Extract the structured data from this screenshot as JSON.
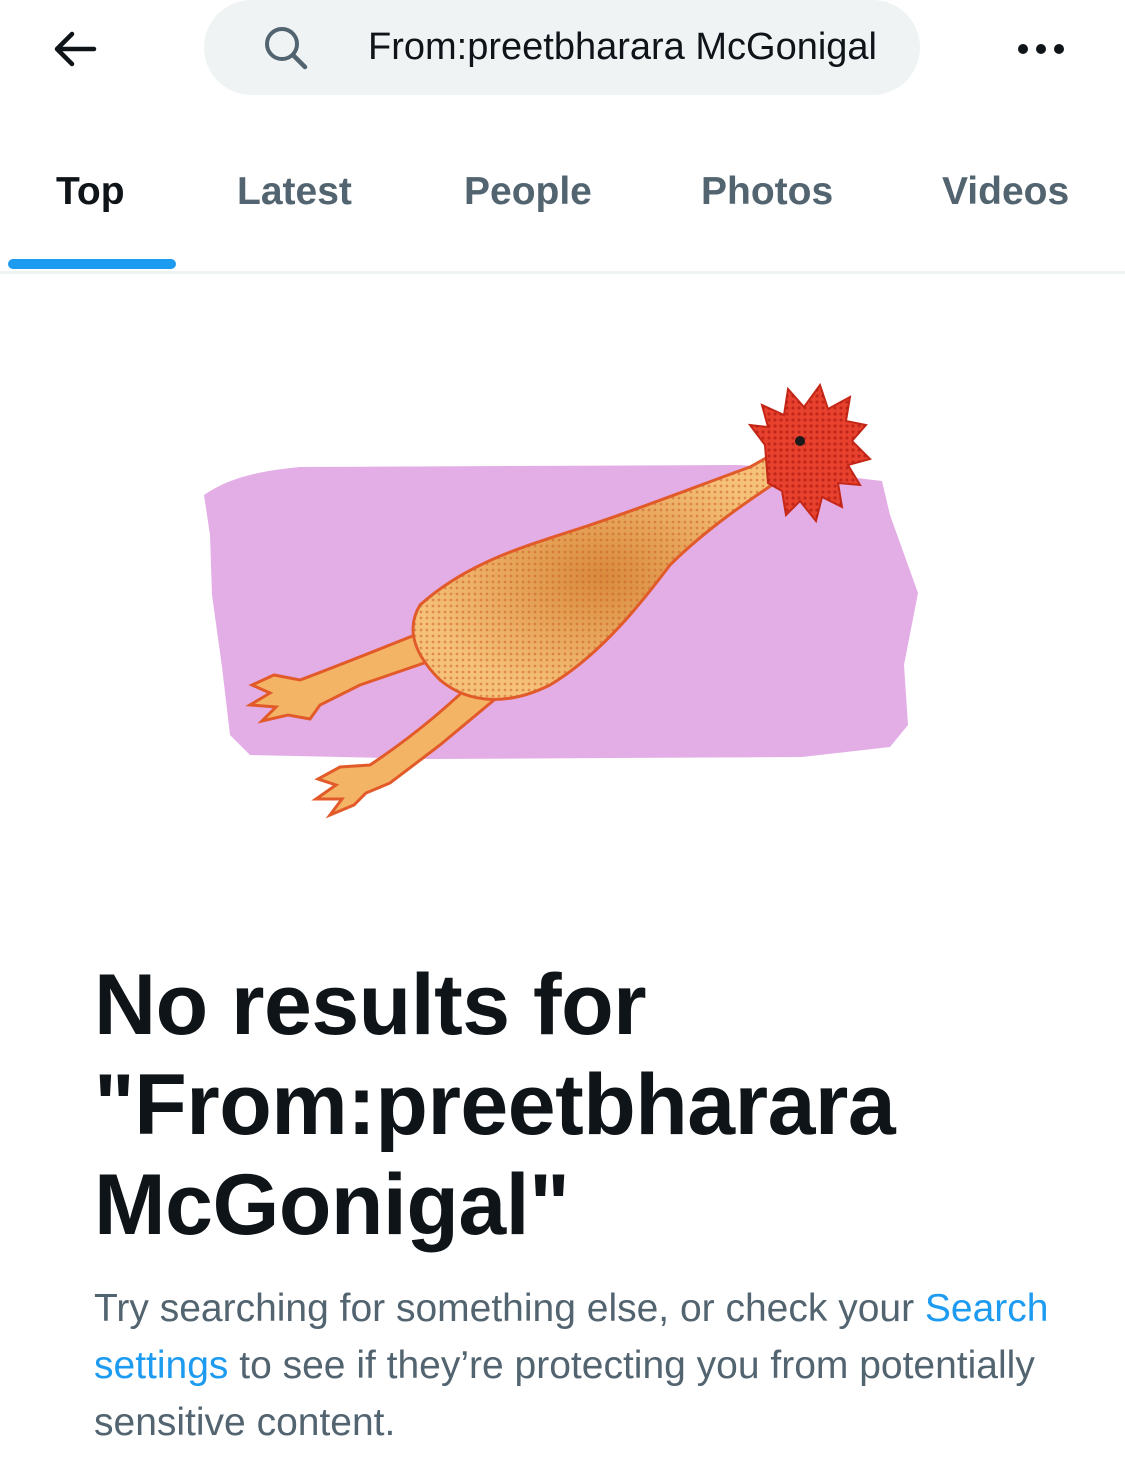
{
  "header": {
    "back_icon": "arrow-left-icon",
    "search_icon": "search-icon",
    "search_query": "From:preetbharara McGonigal",
    "more_icon": "more-horizontal-icon"
  },
  "tabs": [
    {
      "label": "Top",
      "active": true
    },
    {
      "label": "Latest",
      "active": false
    },
    {
      "label": "People",
      "active": false
    },
    {
      "label": "Photos",
      "active": false
    },
    {
      "label": "Videos",
      "active": false
    }
  ],
  "illustration": {
    "name": "rubber-chicken",
    "background_color": "#e3aee5",
    "body_color": "#f3b565",
    "head_color": "#e8422e"
  },
  "empty_state": {
    "title_line1": "No results for",
    "title_line2": "\"From:preetbharara",
    "title_line3": "McGonigal\"",
    "body_before": "Try searching for something else, or check your ",
    "body_link": "Search settings",
    "body_after": " to see if they’re protecting you from potentially sensitive content."
  },
  "colors": {
    "accent": "#1d9bf0",
    "text_primary": "#0f1419",
    "text_secondary": "#536471",
    "search_bg": "#eff3f4"
  }
}
